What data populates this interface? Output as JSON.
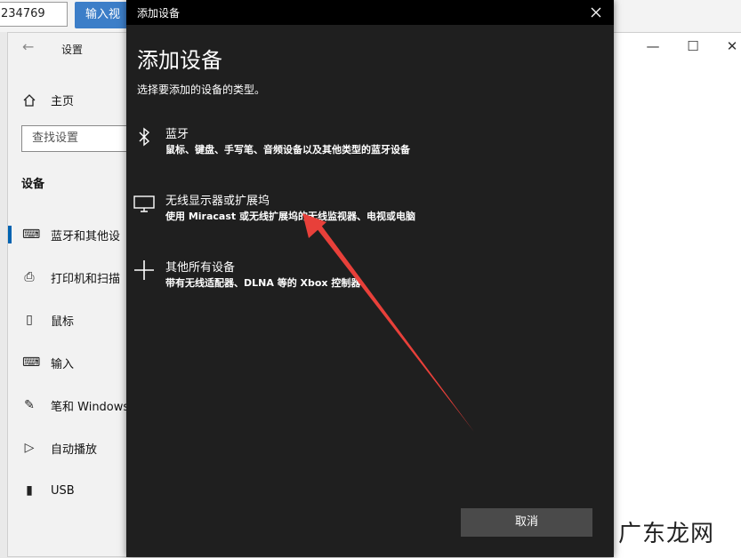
{
  "background": {
    "input_value": "234769",
    "button_label": "输入视"
  },
  "settings": {
    "title": "设置",
    "home_label": "主页",
    "search_placeholder": "查找设置",
    "section_title": "设备",
    "nav": [
      {
        "label": "蓝牙和其他设",
        "icon": "bluetooth-devices-icon",
        "active": true
      },
      {
        "label": "打印机和扫描",
        "icon": "printer-icon"
      },
      {
        "label": "鼠标",
        "icon": "mouse-icon"
      },
      {
        "label": "输入",
        "icon": "keyboard-icon"
      },
      {
        "label": "笔和 Windows",
        "icon": "pen-icon"
      },
      {
        "label": "自动播放",
        "icon": "autoplay-icon"
      },
      {
        "label": "USB",
        "icon": "usb-icon"
      }
    ]
  },
  "dialog": {
    "title": "添加设备",
    "heading": "添加设备",
    "subtitle": "选择要添加的设备的类型。",
    "options": [
      {
        "name": "蓝牙",
        "desc": "鼠标、键盘、手写笔、音频设备以及其他类型的蓝牙设备",
        "icon": "bluetooth-icon"
      },
      {
        "name": "无线显示器或扩展坞",
        "desc": "使用 Miracast 或无线扩展坞的无线监视器、电视或电脑",
        "icon": "monitor-icon"
      },
      {
        "name": "其他所有设备",
        "desc": "带有无线适配器、DLNA 等的 Xbox 控制器",
        "icon": "plus-icon"
      }
    ],
    "cancel_label": "取消"
  },
  "watermark": "广东龙网",
  "colors": {
    "dialog_bg": "#1f1f1f",
    "arrow": "#e8403a",
    "accent": "#0063b1"
  }
}
